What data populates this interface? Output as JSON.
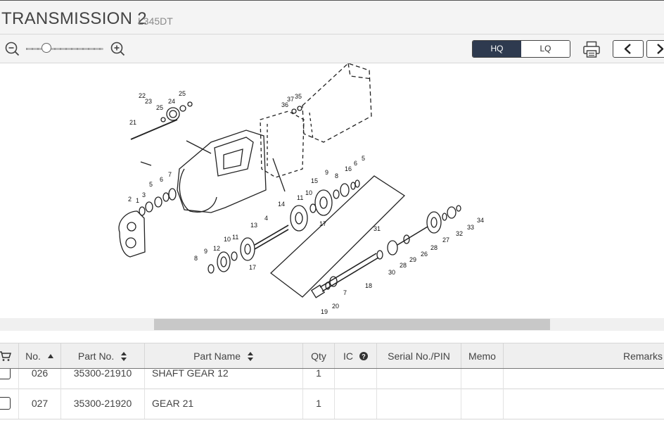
{
  "header": {
    "title": "TRANSMISSION 2",
    "model": "L345DT"
  },
  "toolbar": {
    "zoom_out_icon": "zoom-out-icon",
    "zoom_in_icon": "zoom-in-icon",
    "zoom_level": 0.3,
    "quality_hq": "HQ",
    "quality_lq": "LQ",
    "quality_selected": "HQ",
    "print_icon": "printer-icon",
    "prev_icon": "chevron-left-icon",
    "next_icon": "chevron-right-icon"
  },
  "diagram": {
    "callouts": [
      "1",
      "2",
      "3",
      "4",
      "5",
      "5",
      "6",
      "6",
      "7",
      "7",
      "8",
      "8",
      "9",
      "9",
      "10",
      "10",
      "11",
      "11",
      "12",
      "13",
      "14",
      "15",
      "16",
      "17",
      "17",
      "18",
      "19",
      "20",
      "21",
      "22",
      "23",
      "24",
      "25",
      "25",
      "26",
      "27",
      "28",
      "28",
      "29",
      "30",
      "31",
      "32",
      "33",
      "34",
      "35",
      "36",
      "37"
    ]
  },
  "table": {
    "columns": [
      "No.",
      "Part No.",
      "Part Name",
      "Qty",
      "IC",
      "Serial No./PIN",
      "Memo",
      "Remarks"
    ],
    "cart_icon": "cart-icon",
    "help_icon": "help-circle-icon",
    "rows": [
      {
        "no": "026",
        "part_no": "35300-21910",
        "part_name": "SHAFT GEAR 12",
        "qty": "1",
        "ic": "",
        "serial": "",
        "memo": "",
        "remarks": ""
      },
      {
        "no": "027",
        "part_no": "35300-21920",
        "part_name": "GEAR 21",
        "qty": "1",
        "ic": "",
        "serial": "",
        "memo": "",
        "remarks": ""
      }
    ]
  },
  "colors": {
    "accent": "#2e3a4f",
    "header_bg": "#f4f4f4",
    "table_header_bg": "#efefef"
  }
}
